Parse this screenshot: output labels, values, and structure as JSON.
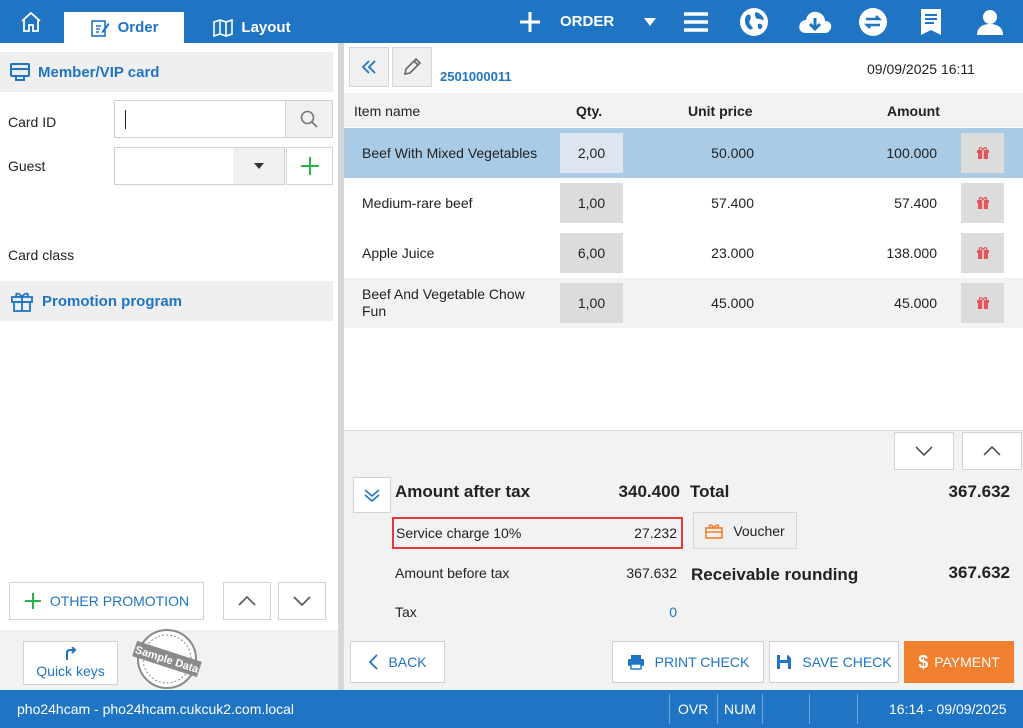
{
  "colors": {
    "brand": "#1f74c4",
    "selected_row": "#a9cbe6",
    "highlight_box": "#e03a3a",
    "payment": "#f07f2e",
    "gift_icon": "#e0565b"
  },
  "topbar": {
    "tabs": [
      {
        "label": "Order",
        "icon": "edit-icon"
      },
      {
        "label": "Layout",
        "icon": "map-icon"
      }
    ],
    "order_button": "ORDER",
    "icons": [
      "home-icon",
      "plus-icon",
      "caret-down-icon",
      "menu-icon",
      "globe-icon",
      "cloud-download-icon",
      "sync-icon",
      "receipt-icon",
      "user-icon"
    ]
  },
  "left": {
    "member_header": "Member/VIP card",
    "card_id_label": "Card ID",
    "card_id_value": "",
    "guest_label": "Guest",
    "guest_value": "",
    "card_class_label": "Card class",
    "promotion_header": "Promotion program",
    "other_promotion": "OTHER PROMOTION",
    "quick_keys": "Quick keys",
    "stamp": "Sample Data"
  },
  "order": {
    "number": "2501000011",
    "datetime": "09/09/2025 16:11",
    "columns": {
      "name": "Item name",
      "qty": "Qty.",
      "unit_price": "Unit price",
      "amount": "Amount"
    },
    "items": [
      {
        "name": "Beef With Mixed Vegetables",
        "qty": "2,00",
        "unit_price": "50.000",
        "amount": "100.000"
      },
      {
        "name": "Medium-rare beef",
        "qty": "1,00",
        "unit_price": "57.400",
        "amount": "57.400"
      },
      {
        "name": "Apple Juice",
        "qty": "6,00",
        "unit_price": "23.000",
        "amount": "138.000"
      },
      {
        "name": "Beef And Vegetable Chow Fun",
        "qty": "1,00",
        "unit_price": "45.000",
        "amount": "45.000"
      }
    ]
  },
  "summary": {
    "amount_after_tax_label": "Amount after tax",
    "amount_after_tax": "340.400",
    "service_charge_label": "Service charge 10%",
    "service_charge": "27.232",
    "amount_before_tax_label": "Amount before tax",
    "amount_before_tax": "367.632",
    "tax_label": "Tax",
    "tax": "0",
    "total_label": "Total",
    "total": "367.632",
    "voucher": "Voucher",
    "receivable_label": "Receivable rounding",
    "receivable": "367.632"
  },
  "actions": {
    "back": "BACK",
    "print_check": "PRINT CHECK",
    "save_check": "SAVE CHECK",
    "payment": "PAYMENT"
  },
  "status": {
    "host": "pho24hcam - pho24hcam.cukcuk2.com.local",
    "ovr": "OVR",
    "num": "NUM",
    "time": "16:14 - 09/09/2025"
  }
}
